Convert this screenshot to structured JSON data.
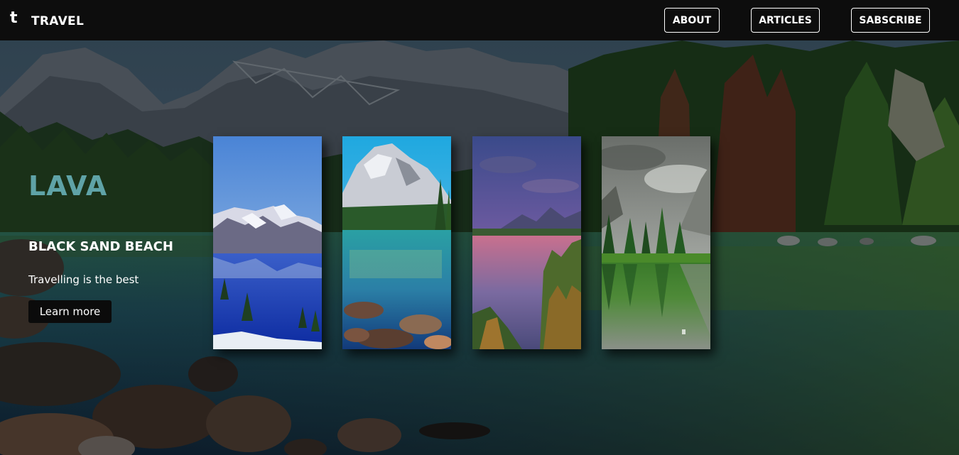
{
  "header": {
    "logo_mark": "t",
    "brand": "TRAVEL",
    "nav": {
      "about": "ABOUT",
      "articles": "ARTICLES",
      "subscribe": "SABSCRIBE"
    }
  },
  "hero": {
    "title": "LAVA",
    "subtitle": "BLACK SAND BEACH",
    "text": "Travelling is the best",
    "cta": "Learn more"
  },
  "colors": {
    "title_accent": "#5fa3a7",
    "nav_bg": "#0d0d0d"
  }
}
